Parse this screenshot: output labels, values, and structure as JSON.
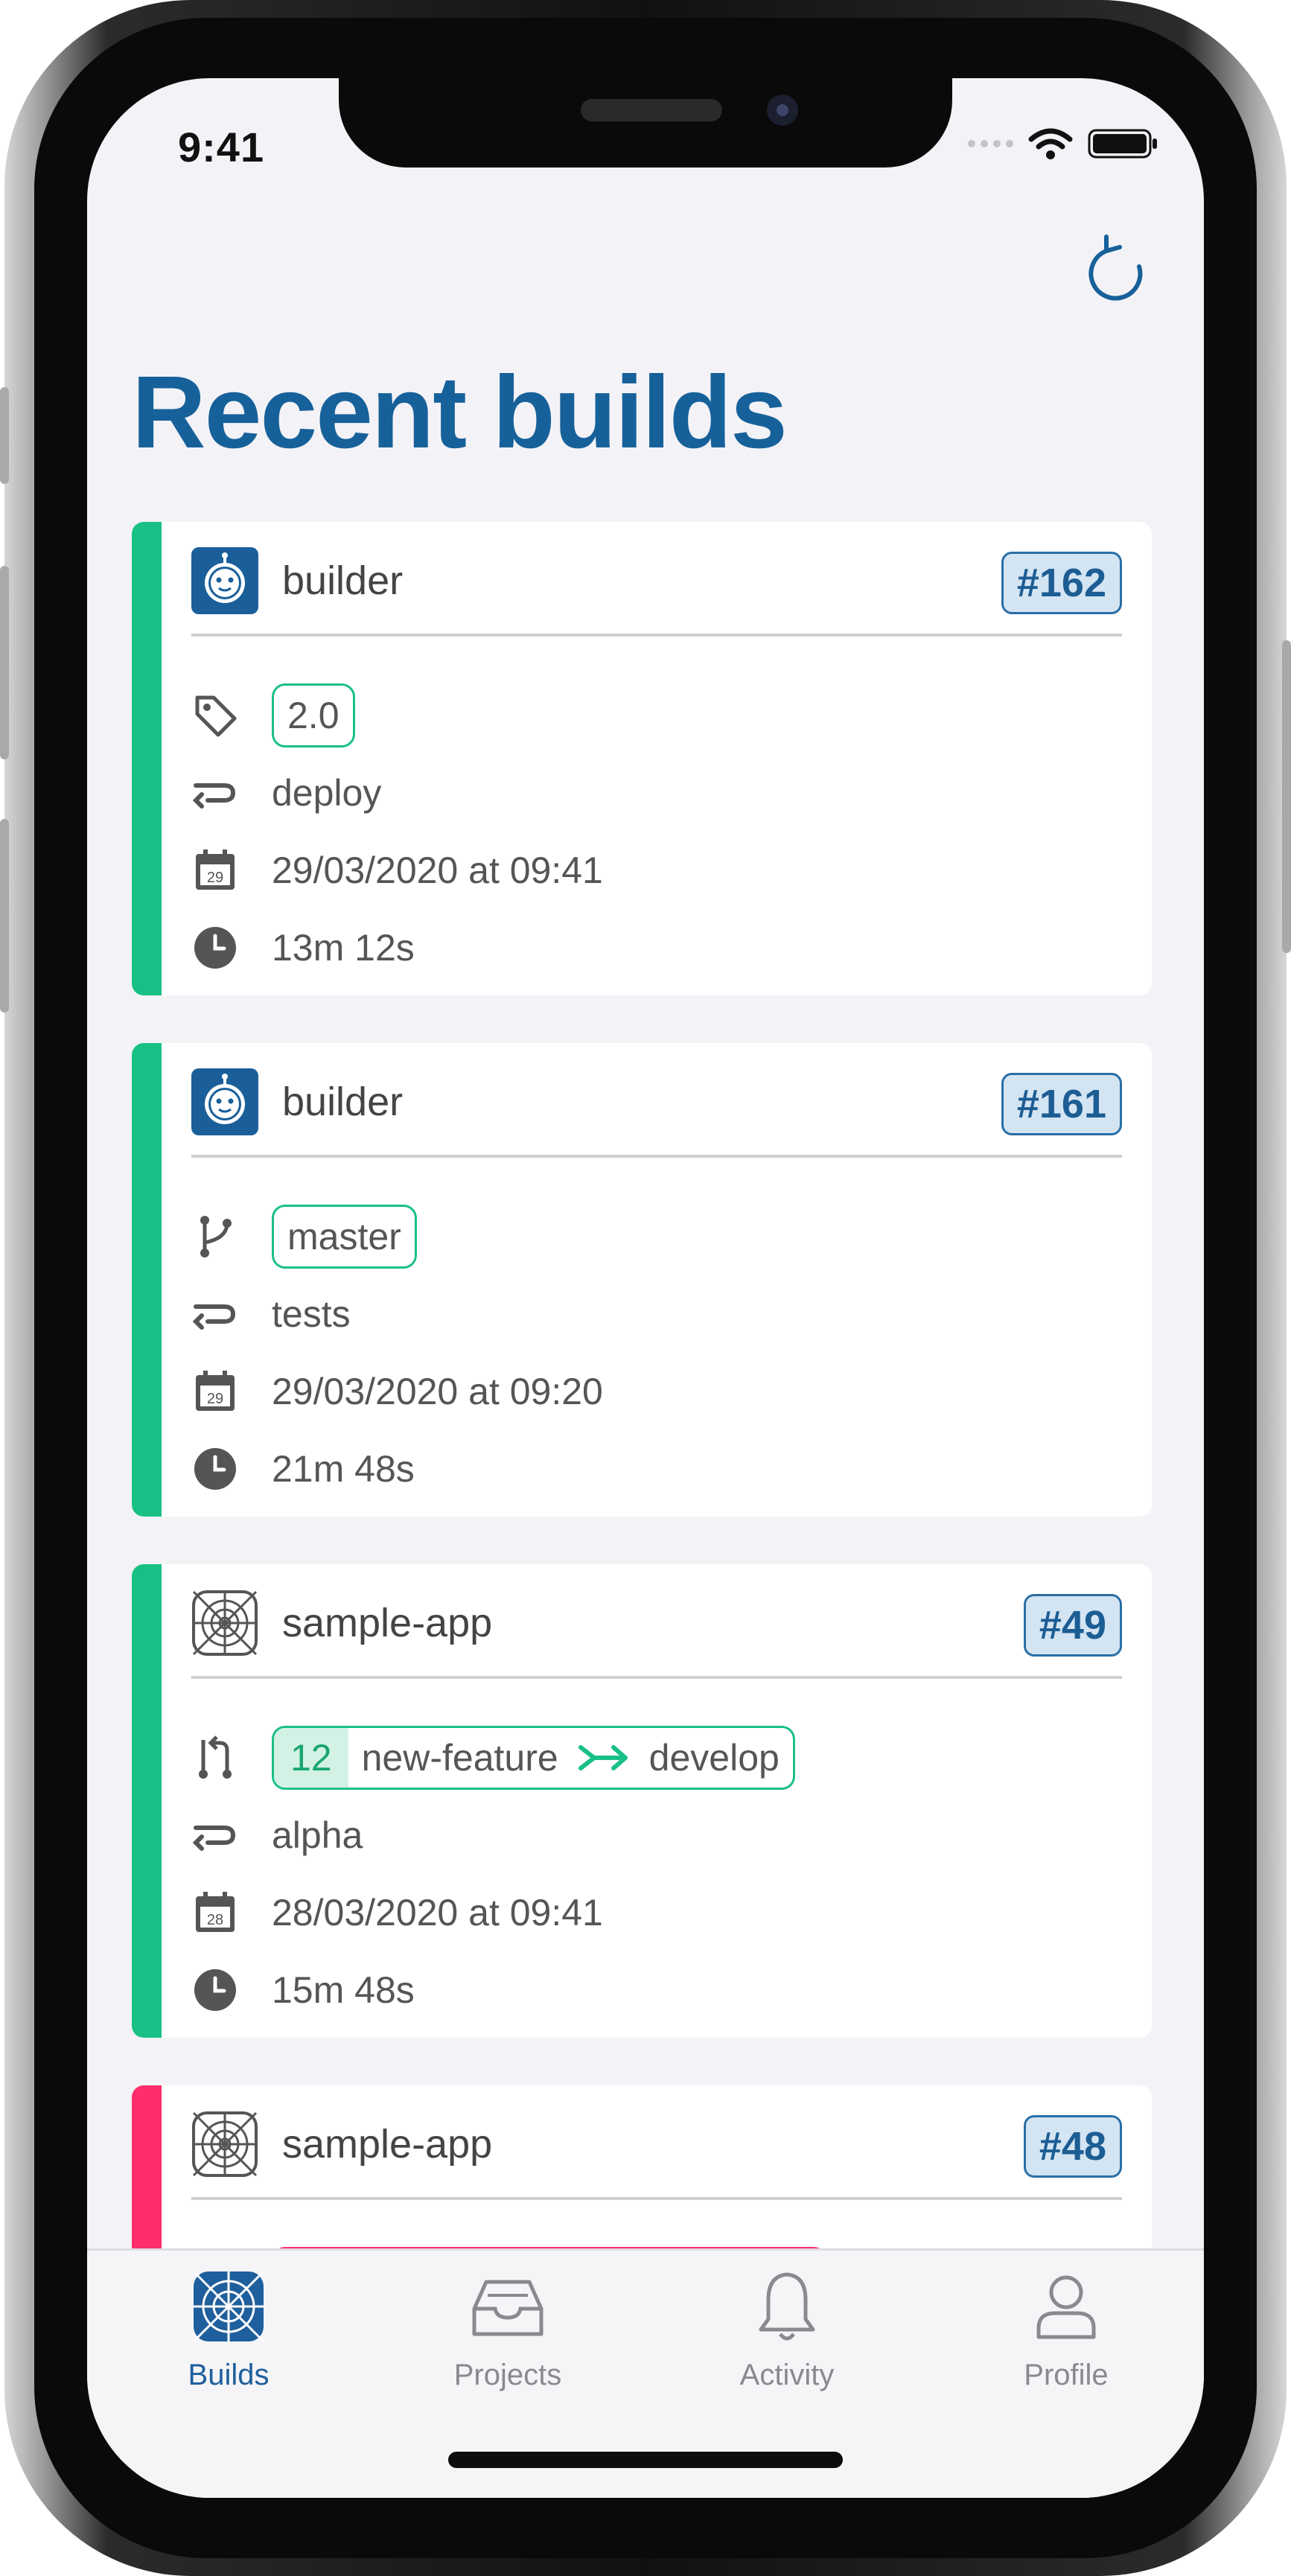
{
  "status": {
    "time": "9:41"
  },
  "page": {
    "title": "Recent builds"
  },
  "colors": {
    "accent": "#17619a",
    "success": "#19c085",
    "failure": "#ff2d6a",
    "badge_bg": "#d3e4f3"
  },
  "builds": [
    {
      "project": "builder",
      "project_icon": "robot-icon",
      "number": "#162",
      "ref_type": "tag",
      "ref": "2.0",
      "workflow": "deploy",
      "date": "29/03/2020 at 09:41",
      "calendar_day": "29",
      "duration": "13m 12s",
      "status": "success"
    },
    {
      "project": "builder",
      "project_icon": "robot-icon",
      "number": "#161",
      "ref_type": "branch",
      "ref": "master",
      "workflow": "tests",
      "date": "29/03/2020 at 09:20",
      "calendar_day": "29",
      "duration": "21m 48s",
      "status": "success"
    },
    {
      "project": "sample-app",
      "project_icon": "app-icon",
      "number": "#49",
      "ref_type": "pull-request",
      "pr_number": "12",
      "pr_source": "new-feature",
      "pr_target": "develop",
      "workflow": "alpha",
      "date": "28/03/2020 at 09:41",
      "calendar_day": "28",
      "duration": "15m 48s",
      "status": "success"
    },
    {
      "project": "sample-app",
      "project_icon": "app-icon",
      "number": "#48",
      "status": "failure"
    }
  ],
  "tabs": [
    {
      "label": "Builds",
      "icon": "builds-icon",
      "active": true
    },
    {
      "label": "Projects",
      "icon": "inbox-icon",
      "active": false
    },
    {
      "label": "Activity",
      "icon": "bell-icon",
      "active": false
    },
    {
      "label": "Profile",
      "icon": "person-icon",
      "active": false
    }
  ]
}
